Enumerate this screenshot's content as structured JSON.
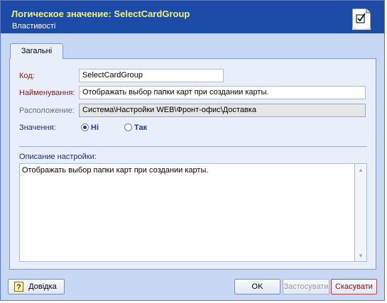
{
  "window": {
    "title": "Логическое значение:  SelectCardGroup",
    "subtitle": "Властивості",
    "header_icon": "document-check-icon",
    "accent_color": "#1d4ba8",
    "title_color": "#f2f276"
  },
  "tabs": [
    {
      "label": "Загальні",
      "active": true
    }
  ],
  "form": {
    "code": {
      "label": "Код:",
      "value": "SelectCardGroup"
    },
    "name": {
      "label": "Найменування:",
      "value": "Отображать выбор папки карт при создании карты."
    },
    "location": {
      "label": "Расположение:",
      "value": "Система\\Настройки WEB\\Фронт-офис\\Доставка"
    },
    "value": {
      "label": "Значення:",
      "options": [
        {
          "label": "Ні",
          "selected": true
        },
        {
          "label": "Так",
          "selected": false
        }
      ]
    },
    "description": {
      "label": "Описание настройки:",
      "value": "Отображать выбор папки карт при создании карты."
    }
  },
  "buttons": {
    "help": "Довідка",
    "ok": "OK",
    "apply": "Застосувати",
    "cancel": "Скасувати"
  }
}
